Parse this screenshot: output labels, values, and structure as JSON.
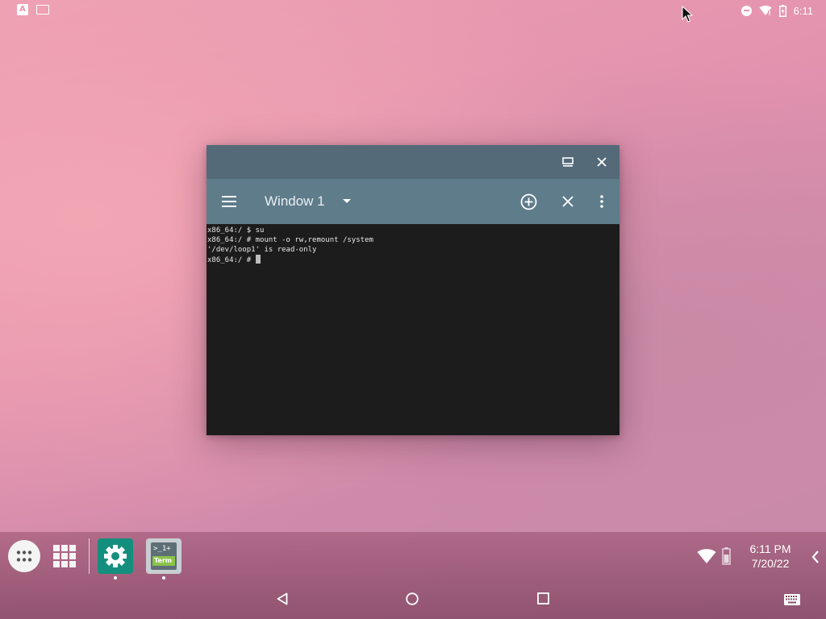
{
  "status_bar": {
    "time": "6:11",
    "left_icons": [
      "keyboard-a-icon",
      "screenshot-icon"
    ],
    "right_icons": [
      "do-not-disturb-icon",
      "wifi-icon",
      "battery-icon"
    ]
  },
  "terminal_window": {
    "caption_buttons": [
      "restore-icon",
      "close-icon"
    ],
    "title": "Window 1",
    "toolbar_icons": [
      "menu-icon",
      "dropdown-arrow-icon",
      "add-window-icon",
      "close-window-icon",
      "overflow-menu-icon"
    ],
    "lines": [
      "x86_64:/ $ su",
      "x86_64:/ # mount -o rw,remount /system",
      "'/dev/loop1' is read-only",
      "x86_64:/ # "
    ]
  },
  "taskbar": {
    "apps": [
      {
        "name": "Settings",
        "icon": "gear-icon"
      },
      {
        "name": "Terminal Emulator",
        "icon": "terminal-icon",
        "label_line1": ">_1+",
        "label_line2": "Term"
      }
    ],
    "time": "6:11 PM",
    "date": "7/20/22",
    "tray_icons": [
      "wifi-icon",
      "battery-icon"
    ]
  },
  "nav_bar": {
    "buttons": [
      "back-icon",
      "home-icon",
      "recents-icon",
      "keyboard-icon"
    ]
  },
  "colors": {
    "caption_bar": "#546a78",
    "app_bar": "#5f7c8b",
    "terminal_bg": "#1c1c1c",
    "settings_icon_bg": "#148f7e"
  }
}
